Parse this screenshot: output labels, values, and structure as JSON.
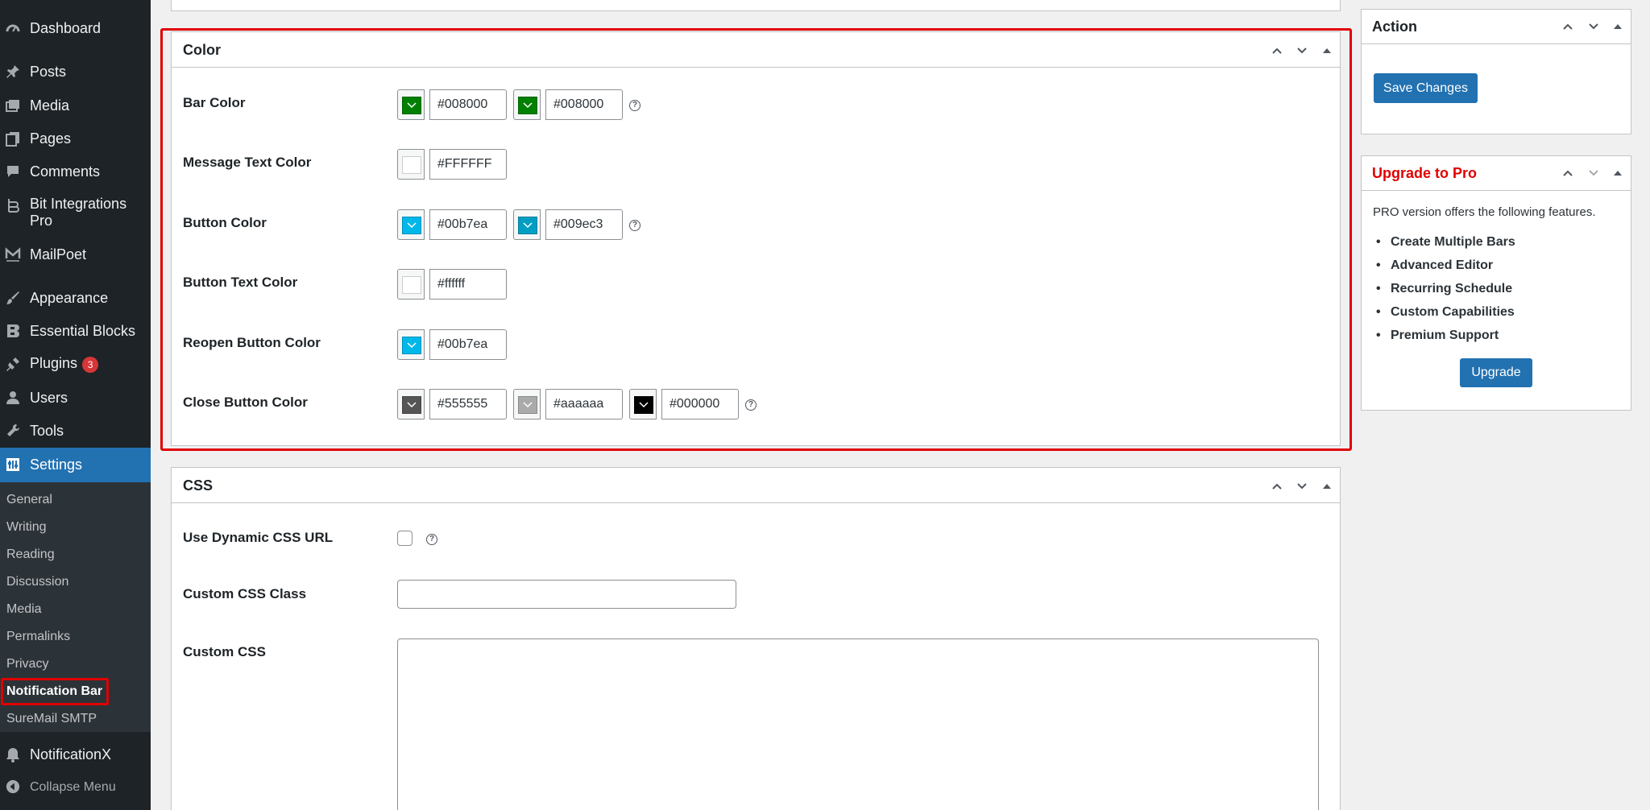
{
  "sidebar": {
    "items": [
      {
        "label": "Dashboard",
        "icon": "dashboard-icon"
      },
      {
        "label": "Posts",
        "icon": "pushpin-icon"
      },
      {
        "label": "Media",
        "icon": "media-icon"
      },
      {
        "label": "Pages",
        "icon": "pages-icon"
      },
      {
        "label": "Comments",
        "icon": "comment-icon"
      },
      {
        "label": "Bit Integrations",
        "label2": "Pro",
        "icon": "bit-integrations-icon"
      },
      {
        "label": "MailPoet",
        "icon": "mailpoet-icon"
      },
      {
        "label": "Appearance",
        "icon": "paintbrush-icon"
      },
      {
        "label": "Essential Blocks",
        "icon": "essential-blocks-icon"
      },
      {
        "label": "Plugins",
        "badge": "3",
        "icon": "plugin-icon"
      },
      {
        "label": "Users",
        "icon": "user-icon"
      },
      {
        "label": "Tools",
        "icon": "wrench-icon"
      },
      {
        "label": "Settings",
        "icon": "settings-icon"
      }
    ],
    "submenu": [
      "General",
      "Writing",
      "Reading",
      "Discussion",
      "Media",
      "Permalinks",
      "Privacy",
      "Notification Bar",
      "SureMail SMTP"
    ],
    "after": [
      {
        "label": "NotificationX",
        "icon": "notificationx-icon"
      },
      {
        "label": "Collapse Menu",
        "icon": "collapse-icon"
      }
    ]
  },
  "color_box": {
    "title": "Color",
    "rows": [
      {
        "label": "Bar Color",
        "values": [
          "#008000",
          "#008000"
        ]
      },
      {
        "label": "Message Text Color",
        "values": [
          "#FFFFFF"
        ]
      },
      {
        "label": "Button Color",
        "values": [
          "#00b7ea",
          "#009ec3"
        ]
      },
      {
        "label": "Button Text Color",
        "values": [
          "#ffffff"
        ]
      },
      {
        "label": "Reopen Button Color",
        "values": [
          "#00b7ea"
        ]
      },
      {
        "label": "Close Button Color",
        "values": [
          "#555555",
          "#aaaaaa",
          "#000000"
        ]
      }
    ],
    "help": "?"
  },
  "css_box": {
    "title": "CSS",
    "dynamic_label": "Use Dynamic CSS URL",
    "class_label": "Custom CSS Class",
    "css_label": "Custom CSS",
    "help": "?"
  },
  "action_box": {
    "title": "Action",
    "save_label": "Save Changes"
  },
  "pro_box": {
    "title": "Upgrade to Pro",
    "intro": "PRO version offers the following features.",
    "features": [
      "Create Multiple Bars",
      "Advanced Editor",
      "Recurring Schedule",
      "Custom Capabilities",
      "Premium Support"
    ],
    "upgrade_label": "Upgrade"
  },
  "colors": {
    "accent": "#2271b1",
    "sidebar_bg": "#1d2327",
    "highlight": "#e00000",
    "pro_title": "#e00000"
  }
}
